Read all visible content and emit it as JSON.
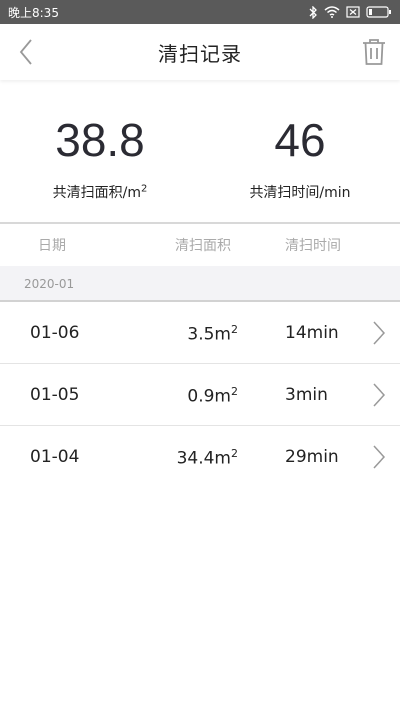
{
  "status_bar": {
    "time": "晚上8:35",
    "icons": [
      "bluetooth-icon",
      "wifi-icon",
      "sim-off-icon",
      "battery-icon"
    ]
  },
  "app_bar": {
    "title": "清扫记录",
    "back_icon": "chevron-left-icon",
    "delete_icon": "trash-icon"
  },
  "summary": {
    "area_value": "38.8",
    "area_label": "共清扫面积/m",
    "area_label_sup": "2",
    "time_value": "46",
    "time_label": "共清扫时间/min"
  },
  "table": {
    "columns": [
      "日期",
      "清扫面积",
      "清扫时间"
    ],
    "month": "2020-01",
    "rows": [
      {
        "date": "01-06",
        "area": "3.5m",
        "area_sup": "2",
        "time": "14min"
      },
      {
        "date": "01-05",
        "area": "0.9m",
        "area_sup": "2",
        "time": "3min"
      },
      {
        "date": "01-04",
        "area": "34.4m",
        "area_sup": "2",
        "time": "29min"
      }
    ]
  },
  "colors": {
    "status_bar": "#5a5a5a",
    "month_row_bg": "#f3f3f6",
    "muted_text": "#aaaaaa"
  }
}
